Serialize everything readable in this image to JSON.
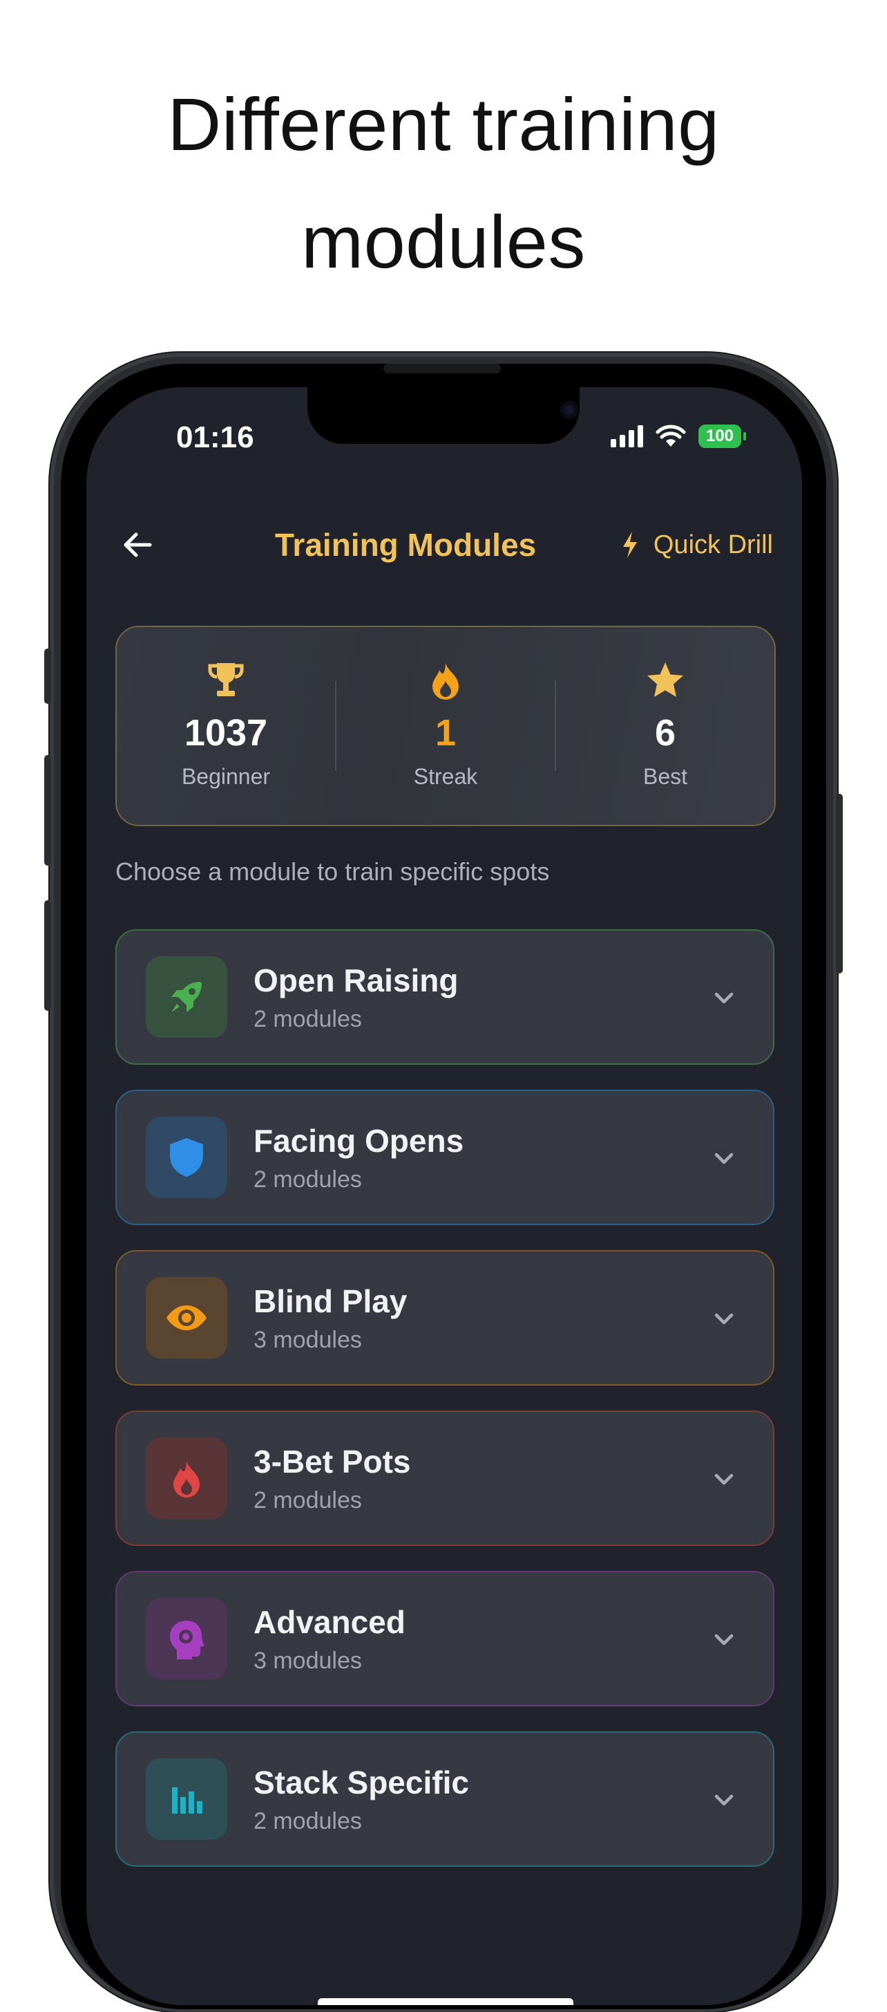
{
  "headline": {
    "line1": "Different training",
    "line2": "modules"
  },
  "status_bar": {
    "time": "01:16",
    "battery": "100"
  },
  "header": {
    "title": "Training Modules",
    "quick_drill_label": "Quick Drill"
  },
  "stats": [
    {
      "value": "1037",
      "label": "Beginner",
      "icon": "trophy-icon"
    },
    {
      "value": "1",
      "label": "Streak",
      "icon": "fire-icon"
    },
    {
      "value": "6",
      "label": "Best",
      "icon": "star-icon"
    }
  ],
  "subtitle": "Choose a module to train specific spots",
  "modules": [
    {
      "name": "Open Raising",
      "count": "2 modules",
      "icon": "rocket-icon",
      "color": "#4caf50",
      "border": "#3f6b4a",
      "icon_bg": "#37523e"
    },
    {
      "name": "Facing Opens",
      "count": "2 modules",
      "icon": "shield-icon",
      "color": "#2f8fe6",
      "border": "#2b5f86",
      "icon_bg": "#304a66"
    },
    {
      "name": "Blind Play",
      "count": "3 modules",
      "icon": "eye-icon",
      "color": "#f39b16",
      "border": "#7a5a26",
      "icon_bg": "#5a4630"
    },
    {
      "name": "3-Bet Pots",
      "count": "2 modules",
      "icon": "fire-icon",
      "color": "#e04646",
      "border": "#7a3a3a",
      "icon_bg": "#5a3538"
    },
    {
      "name": "Advanced",
      "count": "3 modules",
      "icon": "brain-gear-icon",
      "color": "#a640c0",
      "border": "#5e3a6e",
      "icon_bg": "#4c3555"
    },
    {
      "name": "Stack Specific",
      "count": "2 modules",
      "icon": "chart-bars-icon",
      "color": "#19b4c9",
      "border": "#2a6a72",
      "icon_bg": "#2e4f56"
    }
  ]
}
